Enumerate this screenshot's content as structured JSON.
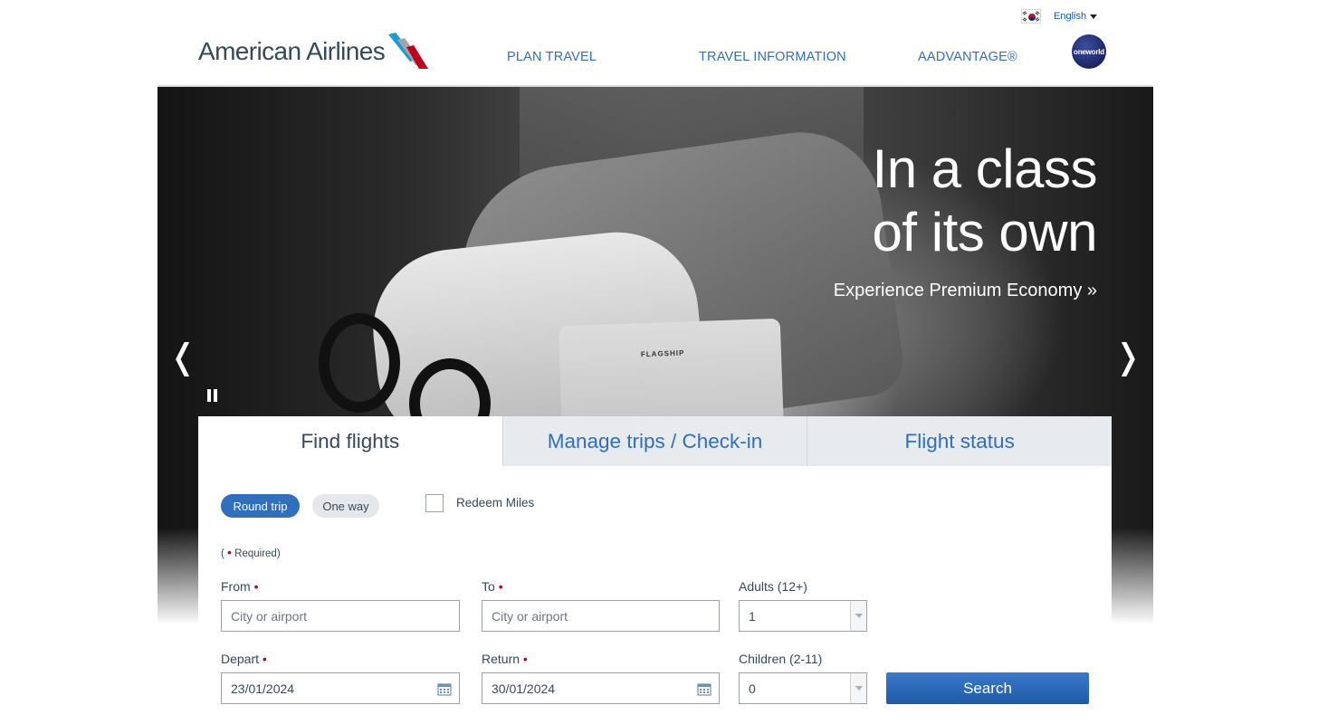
{
  "utility": {
    "language": "English",
    "flag_icon": "korea-flag-icon"
  },
  "header": {
    "logo_text": "American Airlines",
    "nav": [
      "PLAN TRAVEL",
      "TRAVEL INFORMATION",
      "AADVANTAGE®"
    ],
    "oneworld_label": "oneworld"
  },
  "hero": {
    "title_line1": "In a class",
    "title_line2": "of its own",
    "link": "Experience Premium Economy »",
    "pouch_text": "FLAGSHIP",
    "prev_arrow": "❬",
    "next_arrow": "❭"
  },
  "booking": {
    "tabs": [
      "Find flights",
      "Manage trips / Check-in",
      "Flight status"
    ],
    "trip_round": "Round trip",
    "trip_oneway": "One way",
    "redeem": "Redeem Miles",
    "required_open": "(",
    "required_dot": "•",
    "required_text": "Required)",
    "from_label": "From",
    "to_label": "To",
    "adults_label": "Adults (12+)",
    "depart_label": "Depart",
    "return_label": "Return",
    "children_label": "Children (2-11)",
    "from_placeholder": "City or airport",
    "to_placeholder": "City or airport",
    "adults_value": "1",
    "depart_value": "23/01/2024",
    "return_value": "30/01/2024",
    "children_value": "0",
    "search": "Search"
  }
}
